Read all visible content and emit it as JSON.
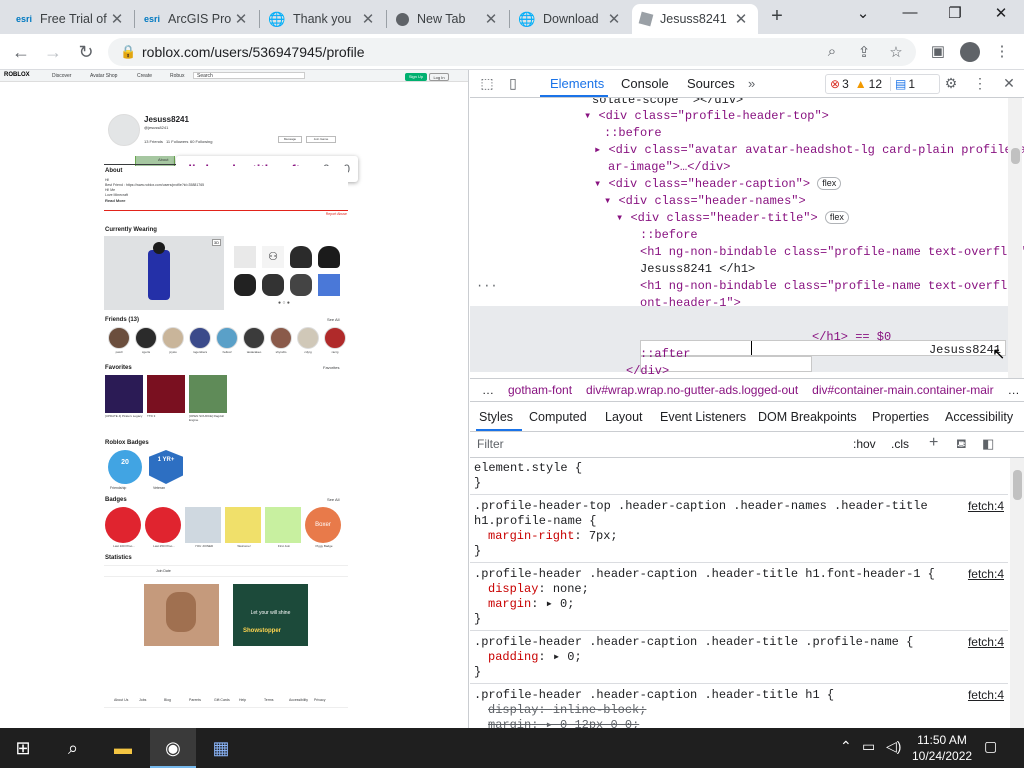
{
  "tabs": [
    {
      "title": "Free Trial of",
      "favicon": "esri"
    },
    {
      "title": "ArcGIS Pro",
      "favicon": "esri"
    },
    {
      "title": "Thank you",
      "favicon": "globe"
    },
    {
      "title": "New Tab",
      "favicon": "chrome"
    },
    {
      "title": "Download",
      "favicon": "globe"
    },
    {
      "title": "Jesuss8241",
      "favicon": "roblox"
    }
  ],
  "toolbar": {
    "url": "roblox.com/users/536947945/profile"
  },
  "roblox": {
    "nav": {
      "logo": "ROBLOX",
      "discover": "Discover",
      "avatar_shop": "Avatar Shop",
      "create": "Create",
      "robux": "Robux",
      "search": "Search",
      "signup": "Sign Up",
      "login": "Log In"
    },
    "username": "Jesuss8241",
    "handle": "@jesuss8241",
    "stats": {
      "friends": "13 Friends",
      "followers": "11 Followers",
      "following": "60 Following"
    },
    "buttons": {
      "message": "Message",
      "join": "Join Game"
    },
    "page_tabs": {
      "about": "About",
      "creations": "Creations"
    },
    "about": {
      "heading": "About",
      "body1": "Hi!",
      "body2": "Best Friend : https://www.roblox.com/users/profile?id=35881765",
      "body3": "Hi! Me",
      "body4": "Love Minecraft",
      "read_more": "Read More",
      "report": "Report Abuse"
    },
    "wearing": {
      "heading": "Currently Wearing",
      "badge3d": "3D"
    },
    "friends": {
      "heading": "Friends (13)",
      "see_all": "See All",
      "names": [
        "pwoll",
        "cgerts",
        "jcysto",
        "rogersbers",
        "helloof",
        "tastacakeo",
        "shyrwllo",
        "cdyrg",
        "racrg"
      ]
    },
    "favorites": {
      "heading": "Favorites",
      "link": "Favorites",
      "items": [
        "[UPDATE 4] Pirate's Legacy",
        "TTD 3",
        "[OPEN SOURCE] Ragdoll Engine"
      ]
    },
    "roblox_badges": {
      "heading": "Roblox Badges",
      "items": [
        "Friendship",
        "Veteran"
      ],
      "b1": "20",
      "b2": "1 YR+"
    },
    "badges": {
      "heading": "Badges",
      "see_all": "See All",
      "items": [
        "Last 100 Priso...",
        "Last 250 Priso...",
        "YOU JOINED",
        "Welcome!",
        "First Join",
        "Piggy Badge"
      ],
      "piggy": "Boxer"
    },
    "statistics": {
      "heading": "Statistics",
      "join_date": "Join Date"
    },
    "footer": [
      "About Us",
      "Jobs",
      "Blog",
      "Parents",
      "Gift Cards",
      "Help",
      "Terms",
      "Accessibility",
      "Privacy"
    ],
    "game_caption": "Let your will shine",
    "game_caption2": "Showstopper"
  },
  "tooltip": {
    "selector": "div.header-title::after",
    "dims": "0 × 0"
  },
  "devtools": {
    "tabs": [
      "Elements",
      "Console",
      "Sources"
    ],
    "errors": "3",
    "warnings": "12",
    "info": "1",
    "dom_lines": [
      "solate-scope \"></div>",
      "<div class=\"profile-header-top\">",
      "::before",
      "<div class=\"avatar avatar-headshot-lg card-plain profile-avat",
      "ar-image\">…</div>",
      "<div class=\"header-caption\">",
      "<div class=\"header-names\">",
      "<div class=\"header-title\">",
      "::before",
      "<h1 ng-non-bindable class=\"profile-name text-overflow\">",
      "Jesuss8241 </h1>",
      "<h1 ng-non-bindable class=\"profile-name text-overflow f",
      "ont-header-1\">",
      "Jesuss8241",
      "</h1> == $0",
      "::after",
      "</div>"
    ],
    "flex": "flex",
    "breadcrumbs": [
      "…",
      "gotham-font",
      "div#wrap.wrap.no-gutter-ads.logged-out",
      "div#container-main.container-mair",
      "…"
    ],
    "subtabs": [
      "Styles",
      "Computed",
      "Layout",
      "Event Listeners",
      "DOM Breakpoints",
      "Properties",
      "Accessibility"
    ],
    "filter_placeholder": "Filter",
    "hov": ":hov",
    "cls": ".cls",
    "rules": [
      {
        "selector": "element.style {",
        "props": [],
        "close": "}",
        "src": ""
      },
      {
        "selector": ".profile-header-top .header-caption .header-names .header-title\nh1.profile-name {",
        "props": [
          {
            "n": "margin-right",
            "v": "7px;",
            "strike": false
          }
        ],
        "close": "}",
        "src": "fetch:4"
      },
      {
        "selector": ".profile-header .header-caption .header-title h1.font-header-1 {",
        "props": [
          {
            "n": "display",
            "v": "none;",
            "strike": false
          },
          {
            "n": "margin",
            "v": "▸ 0;",
            "strike": false
          }
        ],
        "close": "}",
        "src": "fetch:4"
      },
      {
        "selector": ".profile-header .header-caption .header-title .profile-name {",
        "props": [
          {
            "n": "padding",
            "v": "▸ 0;",
            "strike": false
          }
        ],
        "close": "}",
        "src": "fetch:4"
      },
      {
        "selector": ".profile-header .header-caption .header-title h1 {",
        "props": [
          {
            "n": "display",
            "v": "inline-block;",
            "strike": true
          },
          {
            "n": "margin",
            "v": "▸ 0 12px 0 0;",
            "strike": true
          }
        ],
        "close": "",
        "src": "fetch:4"
      }
    ]
  },
  "taskbar": {
    "time": "11:50 AM",
    "date": "10/24/2022"
  }
}
